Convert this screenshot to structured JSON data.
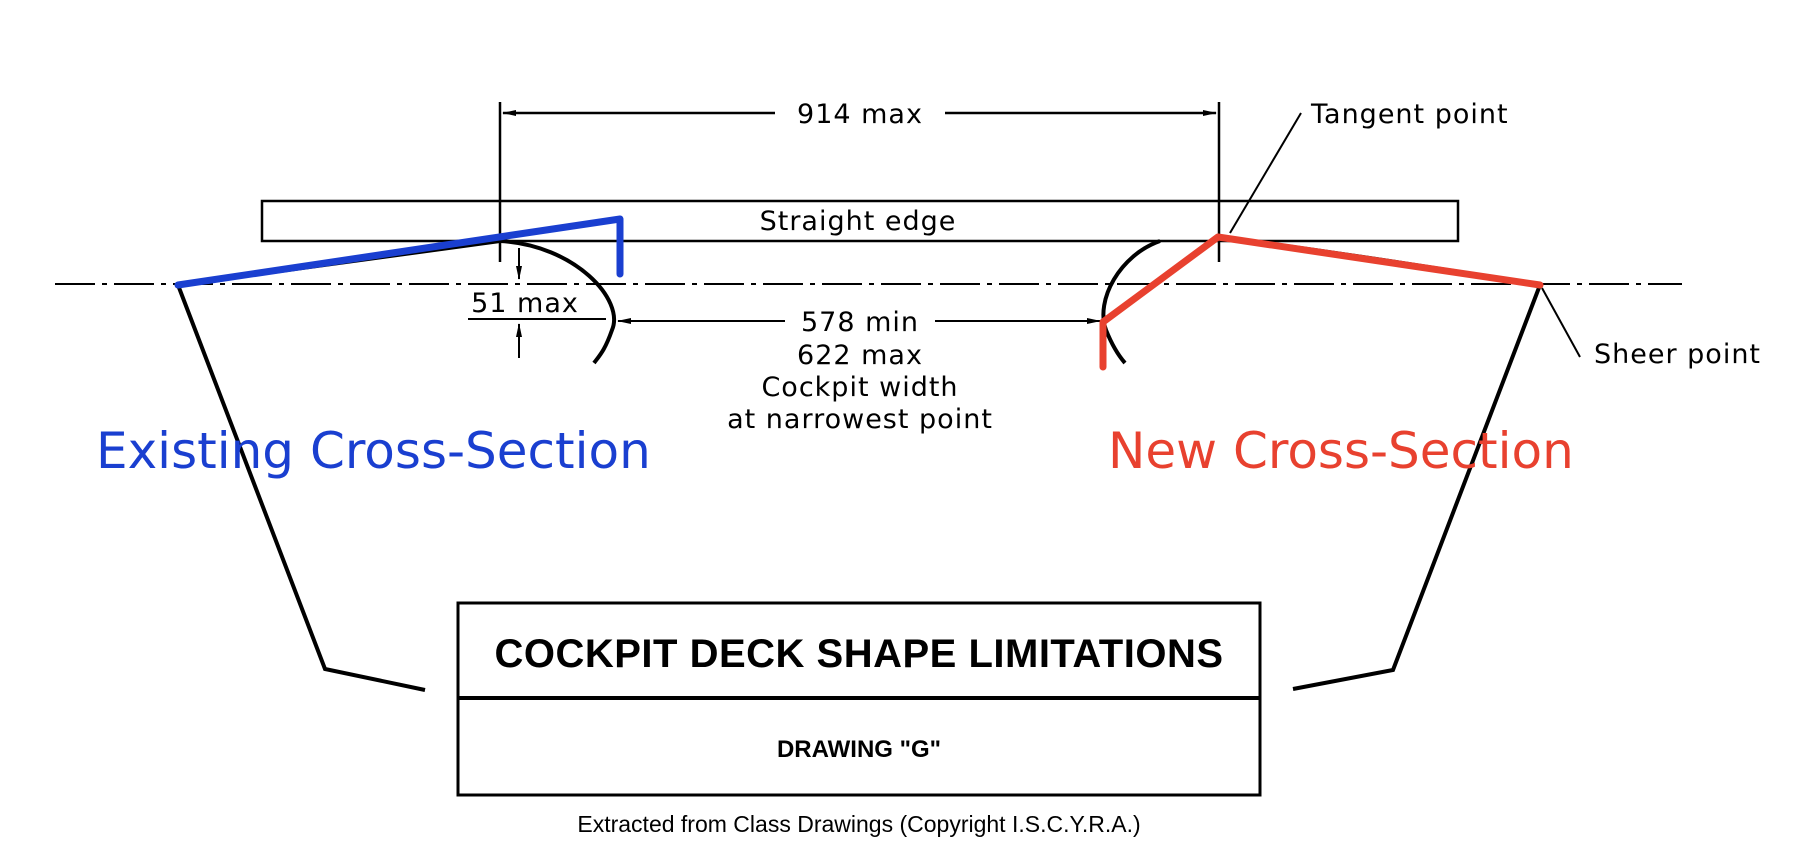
{
  "diagram": {
    "title": "COCKPIT DECK SHAPE LIMITATIONS",
    "subtitle": "DRAWING \"G\"",
    "credit": "Extracted from Class Drawings (Copyright I.S.C.Y.R.A.)",
    "labels": {
      "straight_edge": "Straight edge",
      "tangent_point": "Tangent point",
      "sheer_point": "Sheer point"
    },
    "dimensions": {
      "overall_width": "914 max",
      "deck_depth": "51 max",
      "cockpit_width_min": "578 min",
      "cockpit_width_max": "622 max",
      "cockpit_width_caption_1": "Cockpit width",
      "cockpit_width_caption_2": "at narrowest point"
    },
    "overlays": {
      "existing": {
        "label": "Existing Cross-Section",
        "color": "#1a3fd0"
      },
      "new": {
        "label": "New Cross-Section",
        "color": "#e8412f"
      }
    }
  }
}
